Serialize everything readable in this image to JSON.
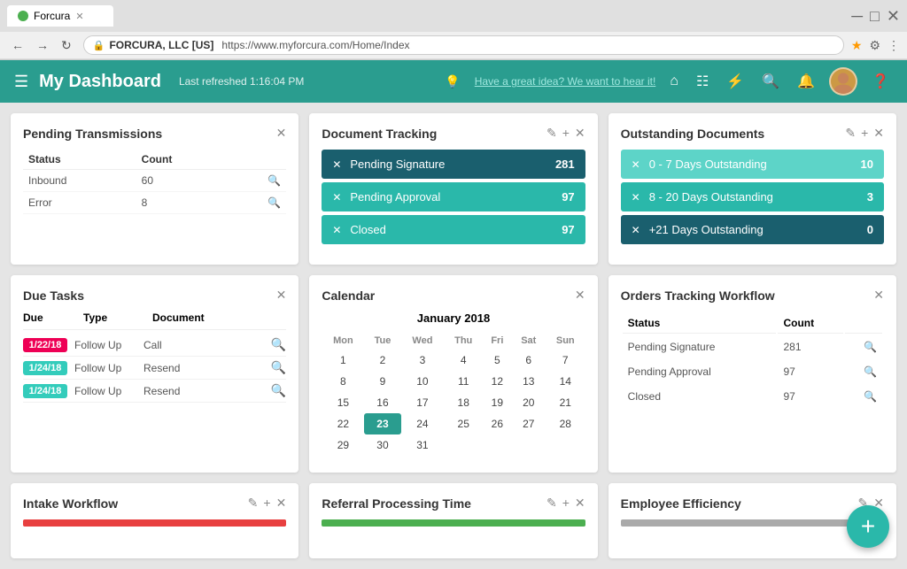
{
  "browser": {
    "tab_title": "Forcura",
    "url": "https://www.myforcura.com/Home/Index",
    "company": "FORCURA, LLC [US]"
  },
  "header": {
    "title": "My Dashboard",
    "subtitle": "Last refreshed 1:16:04 PM",
    "idea_link": "Have a great idea? We want to hear it!"
  },
  "pending_transmissions": {
    "title": "Pending Transmissions",
    "columns": [
      "Status",
      "Count"
    ],
    "rows": [
      {
        "status": "Inbound",
        "count": "60"
      },
      {
        "status": "Error",
        "count": "8"
      }
    ]
  },
  "document_tracking": {
    "title": "Document Tracking",
    "items": [
      {
        "label": "Pending Signature",
        "count": "281",
        "style": "dt-dark"
      },
      {
        "label": "Pending Approval",
        "count": "97",
        "style": "dt-teal"
      },
      {
        "label": "Closed",
        "count": "97",
        "style": "dt-teal"
      }
    ]
  },
  "outstanding_documents": {
    "title": "Outstanding Documents",
    "items": [
      {
        "label": "0 - 7 Days Outstanding",
        "count": "10",
        "style": "od-light-teal"
      },
      {
        "label": "8 - 20 Days Outstanding",
        "count": "3",
        "style": "od-med-teal"
      },
      {
        "label": "+21 Days Outstanding",
        "count": "0",
        "style": "od-dark"
      }
    ]
  },
  "due_tasks": {
    "title": "Due Tasks",
    "columns": [
      "Due",
      "Type",
      "Document"
    ],
    "rows": [
      {
        "date": "1/22/18",
        "date_style": "red",
        "type": "Follow Up",
        "doc": "Call"
      },
      {
        "date": "1/24/18",
        "date_style": "green",
        "type": "Follow Up",
        "doc": "Resend"
      },
      {
        "date": "1/24/18",
        "date_style": "green",
        "type": "Follow Up",
        "doc": "Resend"
      }
    ]
  },
  "calendar": {
    "title": "Calendar",
    "month_year": "January 2018",
    "days": [
      "Mon",
      "Tue",
      "Wed",
      "Thu",
      "Fri",
      "Sat",
      "Sun"
    ],
    "weeks": [
      [
        "1",
        "2",
        "3",
        "4",
        "5",
        "6",
        "7"
      ],
      [
        "8",
        "9",
        "10",
        "11",
        "12",
        "13",
        "14"
      ],
      [
        "15",
        "16",
        "17",
        "18",
        "19",
        "20",
        "21"
      ],
      [
        "22",
        "23",
        "24",
        "25",
        "26",
        "27",
        "28"
      ],
      [
        "29",
        "30",
        "31",
        "",
        "",
        "",
        ""
      ]
    ],
    "today": "23"
  },
  "orders_tracking": {
    "title": "Orders Tracking Workflow",
    "columns": [
      "Status",
      "Count"
    ],
    "rows": [
      {
        "status": "Pending Signature",
        "count": "281"
      },
      {
        "status": "Pending Approval",
        "count": "97"
      },
      {
        "status": "Closed",
        "count": "97"
      }
    ]
  },
  "intake_workflow": {
    "title": "Intake Workflow"
  },
  "referral_processing": {
    "title": "Referral Processing Time"
  },
  "employee_efficiency": {
    "title": "Employee Efficiency"
  },
  "fab": {
    "icon": "+"
  }
}
